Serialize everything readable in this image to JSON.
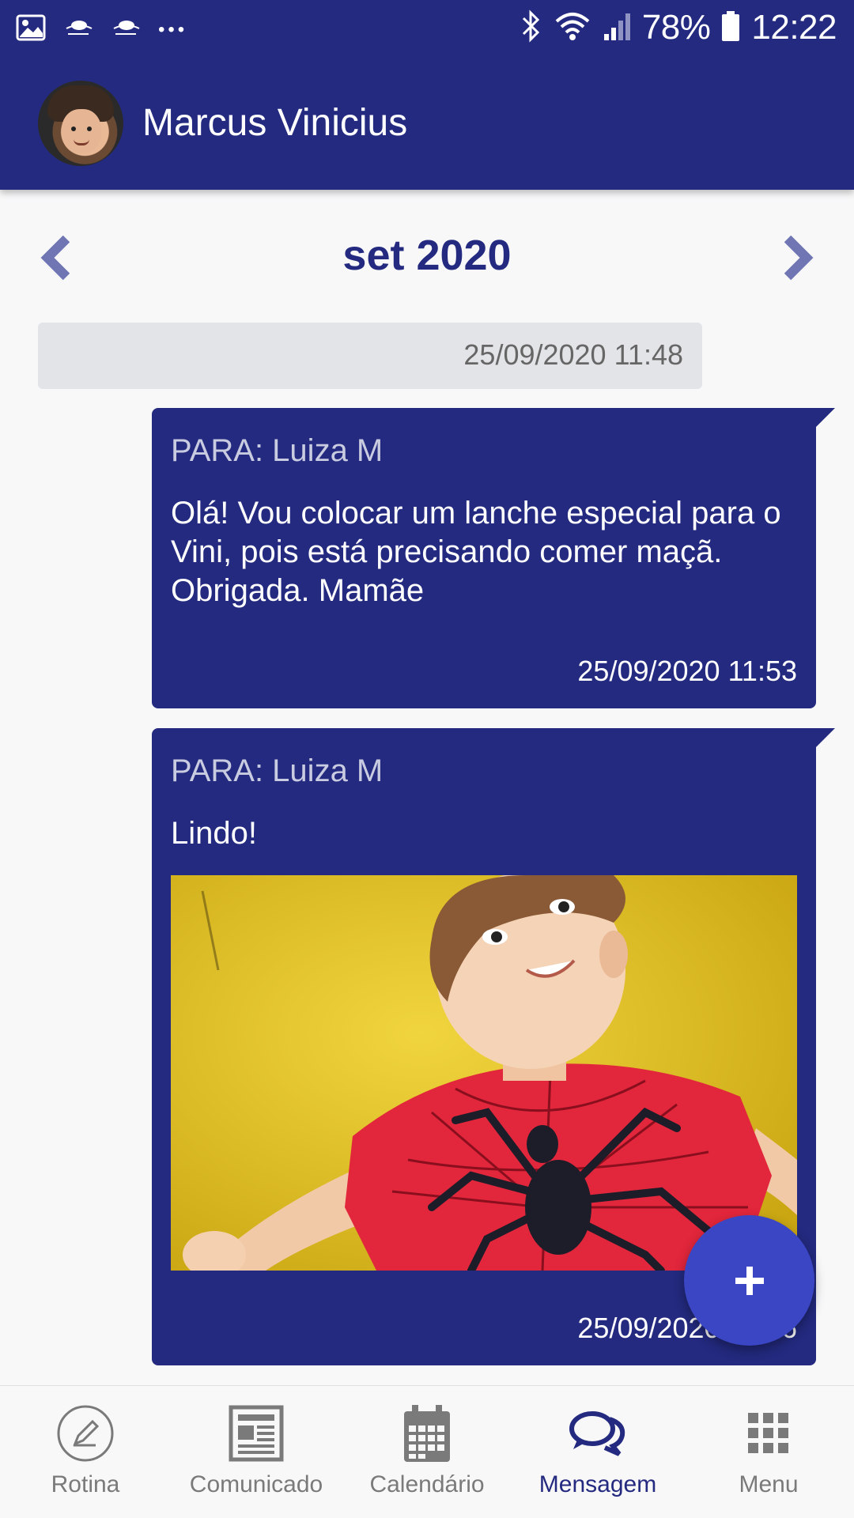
{
  "status_bar": {
    "battery": "78%",
    "time": "12:22",
    "overflow": "•••"
  },
  "app_bar": {
    "title": "Marcus Vinicius"
  },
  "month_nav": {
    "label": "set 2020"
  },
  "messages": {
    "date_separator": "25/09/2020 11:48",
    "items": [
      {
        "to": "PARA: Luiza M",
        "text": "Olá! Vou colocar um lanche especial para o Vini, pois está precisando comer maçã. Obrigada. Mamãe",
        "time": "25/09/2020 11:53"
      },
      {
        "to": "PARA: Luiza M",
        "text": "Lindo!",
        "time": "25/09/2020 11:56"
      }
    ]
  },
  "fab": {
    "icon": "plus-icon"
  },
  "bottom_nav": {
    "items": [
      {
        "label": "Rotina",
        "icon": "pencil-circle-icon"
      },
      {
        "label": "Comunicado",
        "icon": "newspaper-icon"
      },
      {
        "label": "Calendário",
        "icon": "calendar-icon"
      },
      {
        "label": "Mensagem",
        "icon": "chat-bubbles-icon",
        "active": true
      },
      {
        "label": "Menu",
        "icon": "grid-icon"
      }
    ]
  },
  "colors": {
    "primary": "#232a7f",
    "fab": "#3a46c4",
    "background": "#f8f8f9",
    "date_bar": "#e3e4e8"
  }
}
